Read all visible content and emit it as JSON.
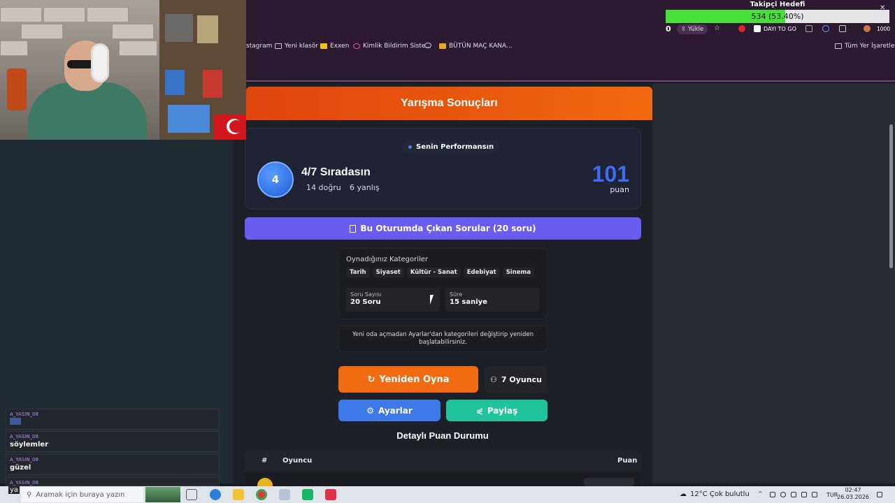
{
  "browser": {
    "bookmarks": [
      {
        "label": "stagram"
      },
      {
        "label": "Yeni klasör"
      },
      {
        "label": "Exxen"
      },
      {
        "label": "Kimlik Bildirim Siste..."
      },
      {
        "label": ""
      },
      {
        "label": "BÜTÜN MAÇ KANA..."
      }
    ],
    "all_bookmarks": "Tüm Yer İşaretleri",
    "toolbar": {
      "count": "0",
      "upload": "Yükle",
      "ext_label": "DAYI TO GO",
      "badge": "1000"
    }
  },
  "follow_goal": {
    "title": "Takipçi Hedefi",
    "value_text": "534 (53.40%)",
    "fraction": 0.534,
    "fill_color": "#4ade3a"
  },
  "results": {
    "header": "Yarışma Sonuçları",
    "perf_label": "Senin Performansın",
    "rank_number": "4",
    "rank_text": "4/7 Sıradasın",
    "correct": "14 doğru",
    "wrong": "6 yanlış",
    "score": "101",
    "score_unit": "puan",
    "questions_button": "Bu Oturumda Çıkan Sorular (20 soru)",
    "categories_title": "Oynadığınız Kategoriler",
    "categories": [
      "Tarih",
      "Siyaset",
      "Kültür - Sanat",
      "Edebiyat",
      "Sinema"
    ],
    "question_count_label": "Soru Sayısı",
    "question_count_value": "20 Soru",
    "duration_label": "Süre",
    "duration_value": "15 saniye",
    "note": "Yeni oda açmadan Ayarlar'dan kategorileri değiştirip yeniden başlatabilirsiniz.",
    "replay_button": "Yeniden Oyna",
    "players_button": "7 Oyuncu",
    "settings_button": "Ayarlar",
    "share_button": "Paylaş",
    "detail_title": "Detaylı Puan Durumu",
    "table_headers": {
      "rank": "#",
      "player": "Oyuncu",
      "score": "Puan"
    },
    "accent_orange": "#f26a12",
    "accent_blue": "#3d6bf2"
  },
  "chat": [
    {
      "user": "A_YASIN_08",
      "msg": ""
    },
    {
      "user": "A_YASIN_08",
      "msg": "söylemler"
    },
    {
      "user": "A_YASIN_08",
      "msg": "güzel"
    },
    {
      "user": "A_YASIN_08",
      "msg": "ya"
    }
  ],
  "taskbar": {
    "search_placeholder": "Aramak için buraya yazın",
    "weather": "12°C  Çok bulutlu",
    "lang": "TUR",
    "time": "02:47",
    "date": "26.03.2026"
  }
}
